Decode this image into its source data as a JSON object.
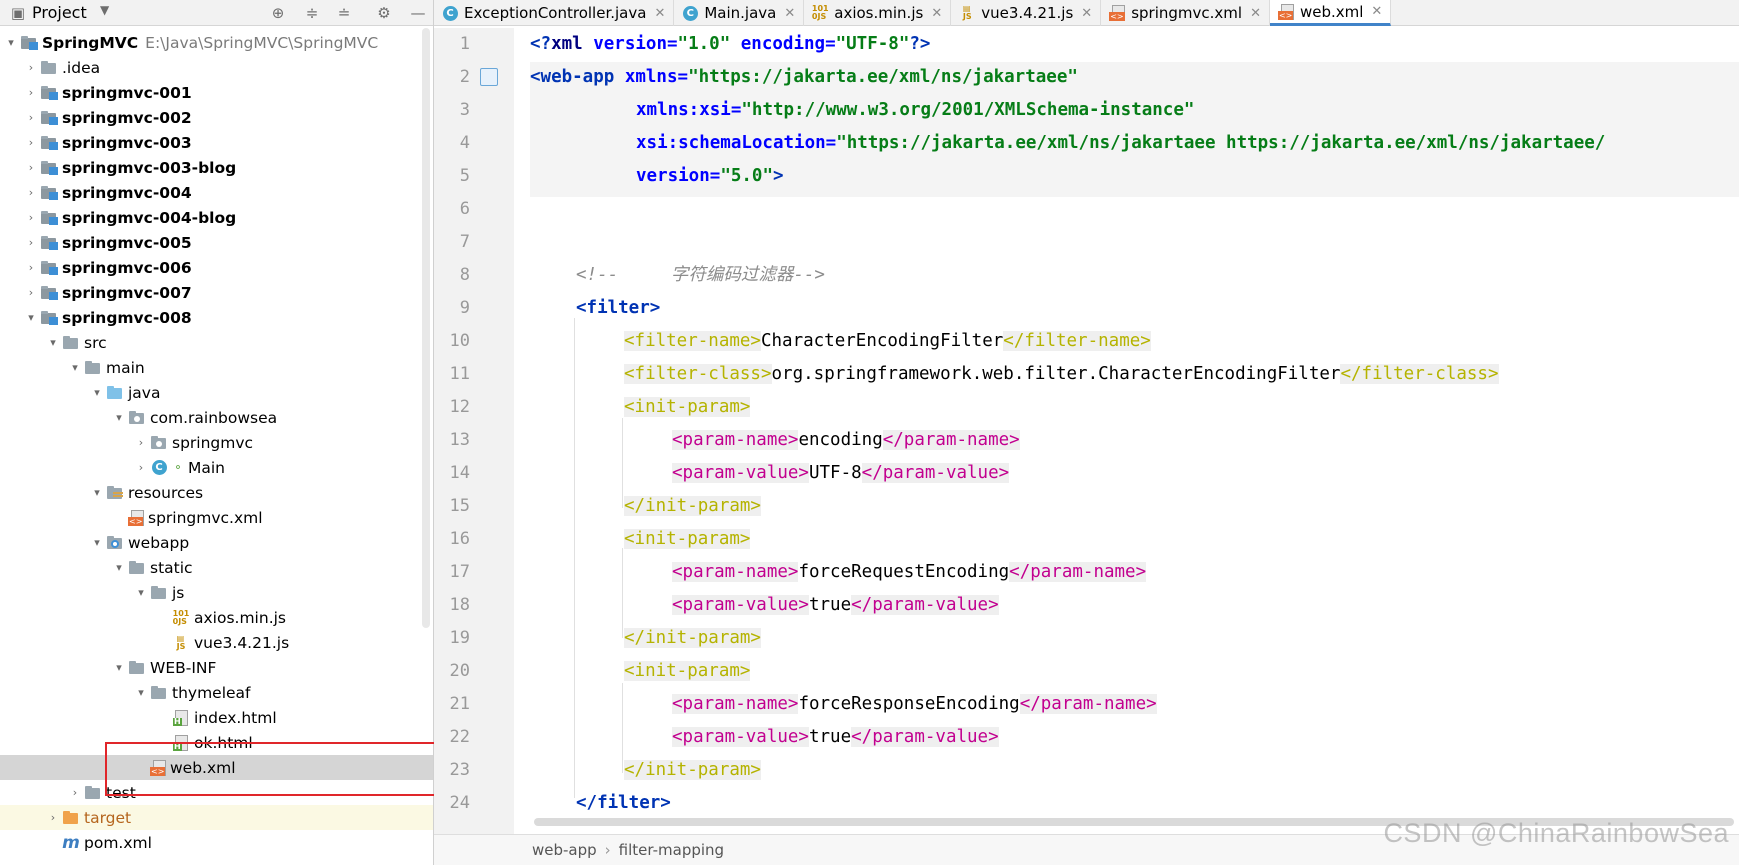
{
  "project_panel": {
    "title": "Project",
    "tree": [
      {
        "label": "SpringMVC",
        "path": "E:\\Java\\SpringMVC\\SpringMVC",
        "bold": true
      },
      {
        "label": ".idea"
      },
      {
        "label": "springmvc-001",
        "bold": true
      },
      {
        "label": "springmvc-002",
        "bold": true
      },
      {
        "label": "springmvc-003",
        "bold": true
      },
      {
        "label": "springmvc-003-blog",
        "bold": true
      },
      {
        "label": "springmvc-004",
        "bold": true
      },
      {
        "label": "springmvc-004-blog",
        "bold": true
      },
      {
        "label": "springmvc-005",
        "bold": true
      },
      {
        "label": "springmvc-006",
        "bold": true
      },
      {
        "label": "springmvc-007",
        "bold": true
      },
      {
        "label": "springmvc-008",
        "bold": true
      },
      {
        "label": "src"
      },
      {
        "label": "main"
      },
      {
        "label": "java"
      },
      {
        "label": "com.rainbowsea"
      },
      {
        "label": "springmvc"
      },
      {
        "label": "Main"
      },
      {
        "label": "resources"
      },
      {
        "label": "springmvc.xml"
      },
      {
        "label": "webapp"
      },
      {
        "label": "static"
      },
      {
        "label": "js"
      },
      {
        "label": "axios.min.js"
      },
      {
        "label": "vue3.4.21.js"
      },
      {
        "label": "WEB-INF"
      },
      {
        "label": "thymeleaf"
      },
      {
        "label": "index.html"
      },
      {
        "label": "ok.html"
      },
      {
        "label": "web.xml"
      },
      {
        "label": "test"
      },
      {
        "label": "target"
      },
      {
        "label": "pom.xml"
      }
    ],
    "selected": "web.xml"
  },
  "editor": {
    "tabs": [
      {
        "label": "ExceptionController.java",
        "icon": "java-class-icon"
      },
      {
        "label": "Main.java",
        "icon": "java-class-icon"
      },
      {
        "label": "axios.min.js",
        "icon": "js-file-icon"
      },
      {
        "label": "vue3.4.21.js",
        "icon": "js-file-icon"
      },
      {
        "label": "springmvc.xml",
        "icon": "xml-file-icon"
      },
      {
        "label": "web.xml",
        "icon": "xml-file-icon",
        "active": true
      }
    ],
    "line_numbers": [
      "1",
      "2",
      "3",
      "4",
      "5",
      "6",
      "7",
      "8",
      "9",
      "10",
      "11",
      "12",
      "13",
      "14",
      "15",
      "16",
      "17",
      "18",
      "19",
      "20",
      "21",
      "22",
      "23",
      "24"
    ],
    "code": {
      "l1": {
        "a": "<?",
        "b": "xml ",
        "c": "version",
        "d": "=",
        "e": "\"1.0\"",
        "f": " encoding",
        "g": "=",
        "h": "\"UTF-8\"",
        "i": "?>"
      },
      "l2": {
        "a": "<web-app ",
        "b": "xmlns",
        "c": "=",
        "d": "\"https://jakarta.ee/xml/ns/jakartaee\""
      },
      "l3": {
        "b": "xmlns:xsi",
        "c": "=",
        "d": "\"http://www.w3.org/2001/XMLSchema-instance\""
      },
      "l4": {
        "b": "xsi:schemaLocation",
        "c": "=",
        "d": "\"https://jakarta.ee/xml/ns/jakartaee https://jakarta.ee/xml/ns/jakartaee/"
      },
      "l5": {
        "b": "version",
        "c": "=",
        "d": "\"5.0\"",
        "e": ">"
      },
      "l8": "<!--     字符编码过滤器-->",
      "l9": "<filter>",
      "l10": {
        "open": "<filter-name>",
        "text": "CharacterEncodingFilter",
        "close": "</filter-name>"
      },
      "l11": {
        "open": "<filter-class>",
        "text": "org.springframework.web.filter.CharacterEncodingFilter",
        "close": "</filter-class>"
      },
      "l12": "<init-param>",
      "l13": {
        "open": "<param-name>",
        "text": "encoding",
        "close": "</param-name>"
      },
      "l14": {
        "open": "<param-value>",
        "text": "UTF-8",
        "close": "</param-value>"
      },
      "l15": "</init-param>",
      "l16": "<init-param>",
      "l17": {
        "open": "<param-name>",
        "text": "forceRequestEncoding",
        "close": "</param-name>"
      },
      "l18": {
        "open": "<param-value>",
        "text": "true",
        "close": "</param-value>"
      },
      "l19": "</init-param>",
      "l20": "<init-param>",
      "l21": {
        "open": "<param-name>",
        "text": "forceResponseEncoding",
        "close": "</param-name>"
      },
      "l22": {
        "open": "<param-value>",
        "text": "true",
        "close": "</param-value>"
      },
      "l23": "</init-param>",
      "l24": "</filter>"
    }
  },
  "breadcrumb": [
    "web-app",
    "filter-mapping"
  ],
  "watermark": "CSDN @ChinaRainbowSea",
  "colors": {
    "accent": "#4083c9",
    "highlight_box": "#e0262a",
    "tag_yellow": "#b5b300",
    "tag_magenta": "#c2008f",
    "string_green": "#067d17"
  }
}
